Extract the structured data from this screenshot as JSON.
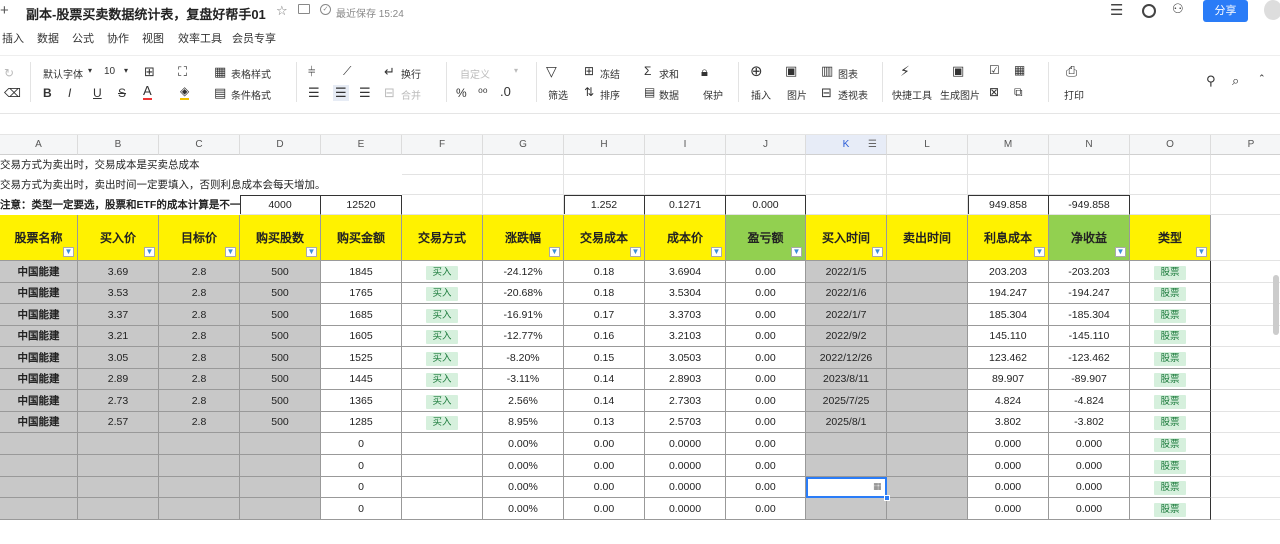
{
  "titlebar": {
    "title": "副本-股票买卖数据统计表，复盘好帮手01",
    "save_status": "最近保存 15:24",
    "share_label": "分享"
  },
  "menu": [
    "插入",
    "数据",
    "公式",
    "协作",
    "视图",
    "效率工具",
    "会员专享"
  ],
  "toolbar": {
    "font_name": "默认字体",
    "font_size": "10",
    "table_style": "表格样式",
    "conditional_format": "条件格式",
    "wrap": "换行",
    "merge": "合并",
    "number_format": "自定义",
    "filter": "筛选",
    "freeze": "冻结",
    "sort": "排序",
    "sum": "求和",
    "data": "数据",
    "protect": "保护",
    "insert": "插入",
    "image": "图片",
    "chart": "图表",
    "pivot": "透视表",
    "quick_tools": "快捷工具",
    "gen_image": "生成图片",
    "print": "打印"
  },
  "columns": [
    "A",
    "B",
    "C",
    "D",
    "E",
    "F",
    "G",
    "H",
    "I",
    "J",
    "K",
    "L",
    "M",
    "N",
    "O",
    "P"
  ],
  "notes": [
    "交易方式为卖出时，交易成本是买卖总成本",
    "交易方式为卖出时，卖出时间一定要填入，否则利息成本会每天增加。",
    "注意：类型一定要选，股票和ETF的成本计算是不一"
  ],
  "summary": {
    "D": "4000",
    "E": "12520",
    "H": "1.252",
    "I": "0.1271",
    "J": "0.000",
    "M": "949.858",
    "N": "-949.858"
  },
  "headers": [
    "股票名称",
    "买入价",
    "目标价",
    "购买股数",
    "购买金额",
    "交易方式",
    "涨跌幅",
    "交易成本",
    "成本价",
    "盈亏额",
    "买入时间",
    "卖出时间",
    "利息成本",
    "净收益",
    "类型"
  ],
  "rows": [
    {
      "name": "中国能建",
      "buy": "3.69",
      "target": "2.8",
      "qty": "500",
      "amount": "1845",
      "mode": "买入",
      "chg": "-24.12%",
      "cost": "0.18",
      "cprice": "3.6904",
      "pl": "0.00",
      "bdate": "2022/1/5",
      "interest": "203.203",
      "net": "-203.203",
      "type": "股票"
    },
    {
      "name": "中国能建",
      "buy": "3.53",
      "target": "2.8",
      "qty": "500",
      "amount": "1765",
      "mode": "买入",
      "chg": "-20.68%",
      "cost": "0.18",
      "cprice": "3.5304",
      "pl": "0.00",
      "bdate": "2022/1/6",
      "interest": "194.247",
      "net": "-194.247",
      "type": "股票"
    },
    {
      "name": "中国能建",
      "buy": "3.37",
      "target": "2.8",
      "qty": "500",
      "amount": "1685",
      "mode": "买入",
      "chg": "-16.91%",
      "cost": "0.17",
      "cprice": "3.3703",
      "pl": "0.00",
      "bdate": "2022/1/7",
      "interest": "185.304",
      "net": "-185.304",
      "type": "股票"
    },
    {
      "name": "中国能建",
      "buy": "3.21",
      "target": "2.8",
      "qty": "500",
      "amount": "1605",
      "mode": "买入",
      "chg": "-12.77%",
      "cost": "0.16",
      "cprice": "3.2103",
      "pl": "0.00",
      "bdate": "2022/9/2",
      "interest": "145.110",
      "net": "-145.110",
      "type": "股票"
    },
    {
      "name": "中国能建",
      "buy": "3.05",
      "target": "2.8",
      "qty": "500",
      "amount": "1525",
      "mode": "买入",
      "chg": "-8.20%",
      "cost": "0.15",
      "cprice": "3.0503",
      "pl": "0.00",
      "bdate": "2022/12/26",
      "interest": "123.462",
      "net": "-123.462",
      "type": "股票"
    },
    {
      "name": "中国能建",
      "buy": "2.89",
      "target": "2.8",
      "qty": "500",
      "amount": "1445",
      "mode": "买入",
      "chg": "-3.11%",
      "cost": "0.14",
      "cprice": "2.8903",
      "pl": "0.00",
      "bdate": "2023/8/11",
      "interest": "89.907",
      "net": "-89.907",
      "type": "股票"
    },
    {
      "name": "中国能建",
      "buy": "2.73",
      "target": "2.8",
      "qty": "500",
      "amount": "1365",
      "mode": "买入",
      "chg": "2.56%",
      "cost": "0.14",
      "cprice": "2.7303",
      "pl": "0.00",
      "bdate": "2025/7/25",
      "interest": "4.824",
      "net": "-4.824",
      "type": "股票"
    },
    {
      "name": "中国能建",
      "buy": "2.57",
      "target": "2.8",
      "qty": "500",
      "amount": "1285",
      "mode": "买入",
      "chg": "8.95%",
      "cost": "0.13",
      "cprice": "2.5703",
      "pl": "0.00",
      "bdate": "2025/8/1",
      "interest": "3.802",
      "net": "-3.802",
      "type": "股票"
    },
    {
      "name": "",
      "buy": "",
      "target": "",
      "qty": "",
      "amount": "0",
      "mode": "",
      "chg": "0.00%",
      "cost": "0.00",
      "cprice": "0.0000",
      "pl": "0.00",
      "bdate": "",
      "interest": "0.000",
      "net": "0.000",
      "type": "股票"
    },
    {
      "name": "",
      "buy": "",
      "target": "",
      "qty": "",
      "amount": "0",
      "mode": "",
      "chg": "0.00%",
      "cost": "0.00",
      "cprice": "0.0000",
      "pl": "0.00",
      "bdate": "",
      "interest": "0.000",
      "net": "0.000",
      "type": "股票"
    },
    {
      "name": "",
      "buy": "",
      "target": "",
      "qty": "",
      "amount": "0",
      "mode": "",
      "chg": "0.00%",
      "cost": "0.00",
      "cprice": "0.0000",
      "pl": "0.00",
      "bdate": "",
      "interest": "0.000",
      "net": "0.000",
      "type": "股票"
    },
    {
      "name": "",
      "buy": "",
      "target": "",
      "qty": "",
      "amount": "0",
      "mode": "",
      "chg": "0.00%",
      "cost": "0.00",
      "cprice": "0.0000",
      "pl": "0.00",
      "bdate": "",
      "interest": "0.000",
      "net": "0.000",
      "type": "股票"
    }
  ]
}
